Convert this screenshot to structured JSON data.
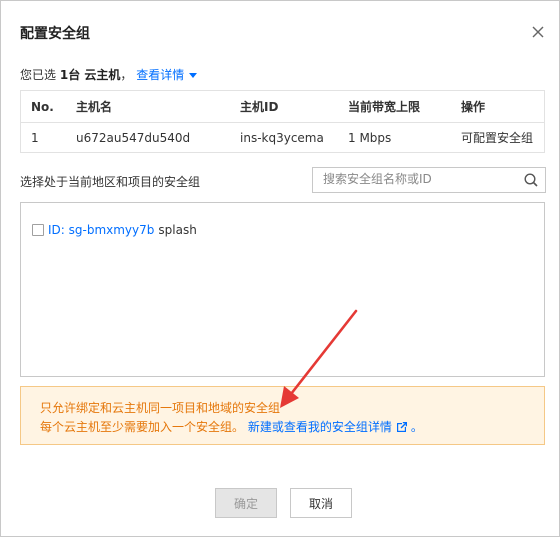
{
  "dialog": {
    "title": "配置安全组",
    "close_icon": "close-icon"
  },
  "selection": {
    "prefix": "您已选",
    "count_text": "1台 云主机",
    "suffix": "，",
    "details_link": "查看详情"
  },
  "hosts_table": {
    "columns": [
      "No.",
      "主机名",
      "主机ID",
      "当前带宽上限",
      "操作"
    ],
    "rows": [
      {
        "no": "1",
        "name": "u672au547du540d",
        "id": "ins-kq3ycema",
        "bandwidth": "1 Mbps",
        "action": "可配置安全组"
      }
    ]
  },
  "security_groups": {
    "hint": "选择处于当前地区和项目的安全组",
    "search_placeholder": "搜索安全组名称或ID",
    "items": [
      {
        "id_label": "ID: sg-bmxmyy7b",
        "name": "splash",
        "checked": false
      }
    ]
  },
  "notice": {
    "line1": "只允许绑定和云主机同一项目和地域的安全组",
    "line2": "每个云主机至少需要加入一个安全组。",
    "link": "新建或查看我的安全组详情",
    "dot": "。"
  },
  "buttons": {
    "ok": "确定",
    "cancel": "取消"
  },
  "colors": {
    "link": "#006eff",
    "notice_text": "#e5770b",
    "notice_bg": "#fff4e3",
    "annotation_arrow": "#e53935"
  }
}
